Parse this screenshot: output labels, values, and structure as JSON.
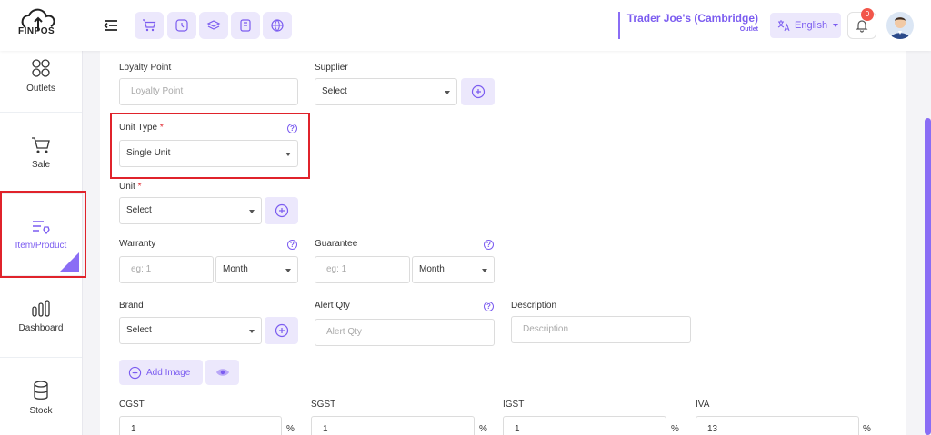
{
  "app": {
    "logo_text": "FINPOS"
  },
  "header": {
    "outlet_name": "Trader Joe's (Cambridge)",
    "outlet_sub": "Outlet",
    "language": "English",
    "notification_count": "0"
  },
  "sidebar": {
    "items": [
      {
        "label": "Outlets"
      },
      {
        "label": "Sale"
      },
      {
        "label": "Item/Product"
      },
      {
        "label": "Dashboard"
      },
      {
        "label": "Stock"
      }
    ]
  },
  "form": {
    "loyalty": {
      "label": "Loyalty Point",
      "placeholder": "Loyalty Point"
    },
    "supplier": {
      "label": "Supplier",
      "value": "Select"
    },
    "unit_type": {
      "label": "Unit Type",
      "required": "*",
      "value": "Single Unit"
    },
    "unit": {
      "label": "Unit",
      "required": "*",
      "value": "Select"
    },
    "warranty": {
      "label": "Warranty",
      "placeholder": "eg: 1",
      "period": "Month"
    },
    "guarantee": {
      "label": "Guarantee",
      "placeholder": "eg: 1",
      "period": "Month"
    },
    "brand": {
      "label": "Brand",
      "value": "Select"
    },
    "alert_qty": {
      "label": "Alert Qty",
      "placeholder": "Alert Qty"
    },
    "description": {
      "label": "Description",
      "placeholder": "Description"
    },
    "add_image_label": "Add Image",
    "help_glyph": "?",
    "percent": "%",
    "taxes": [
      {
        "label": "CGST",
        "value": "1"
      },
      {
        "label": "SGST",
        "value": "1"
      },
      {
        "label": "IGST",
        "value": "1"
      },
      {
        "label": "IVA",
        "value": "13"
      }
    ]
  }
}
